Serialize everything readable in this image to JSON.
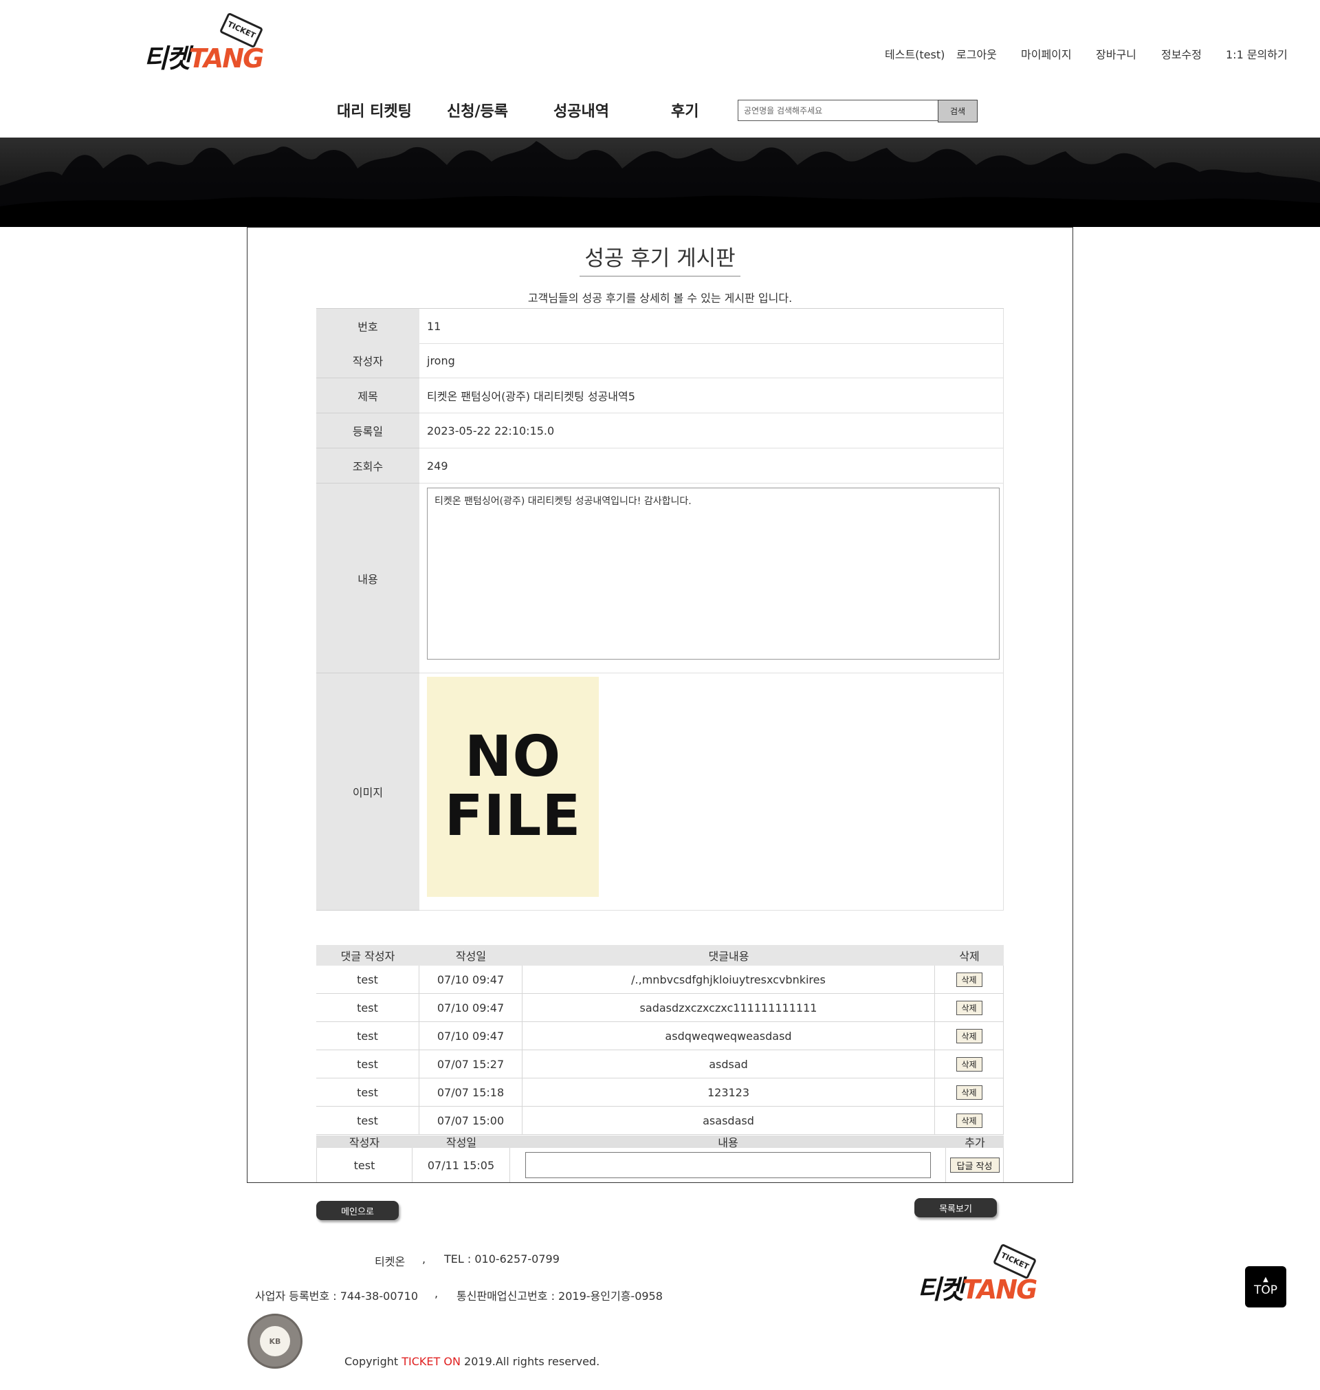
{
  "header": {
    "logo": {
      "kr": "티켓",
      "en": "TANG",
      "tag": "TICKET"
    },
    "top_links": [
      "테스트(test)",
      "로그아웃",
      "마이페이지",
      "장바구니",
      "정보수정",
      "1:1 문의하기"
    ],
    "nav": [
      "대리 티켓팅",
      "신청/등록",
      "성공내역",
      "후기"
    ],
    "search": {
      "placeholder": "공연명을 검색해주세요",
      "button": "검색"
    }
  },
  "board": {
    "title": "성공 후기 게시판",
    "description": "고객님들의 성공 후기를 상세히 볼 수 있는 게시판 입니다.",
    "fields": {
      "number": {
        "label": "번호",
        "value": "11"
      },
      "author": {
        "label": "작성자",
        "value": "jrong"
      },
      "subject": {
        "label": "제목",
        "value": "티켓온 팬텀싱어(광주) 대리티켓팅 성공내역5"
      },
      "date": {
        "label": "등록일",
        "value": "2023-05-22 22:10:15.0"
      },
      "views": {
        "label": "조회수",
        "value": "249"
      },
      "content": {
        "label": "내용",
        "value": "티켓온 팬텀싱어(광주) 대리티켓팅 성공내역입니다! 감사합니다."
      },
      "image": {
        "label": "이미지",
        "placeholder_line1": "NO",
        "placeholder_line2": "FILE"
      }
    }
  },
  "comments": {
    "headers": [
      "댓글 작성자",
      "작성일",
      "댓글내용",
      "삭제"
    ],
    "rows": [
      {
        "author": "test",
        "date": "07/10 09:47",
        "content": "/.,mnbvcsdfghjkloiuytresxcvbnkires",
        "delete": "삭제"
      },
      {
        "author": "test",
        "date": "07/10 09:47",
        "content": "sadasdzxczxczxc111111111111",
        "delete": "삭제"
      },
      {
        "author": "test",
        "date": "07/10 09:47",
        "content": "asdqweqweqweasdasd",
        "delete": "삭제"
      },
      {
        "author": "test",
        "date": "07/07 15:27",
        "content": "asdsad",
        "delete": "삭제"
      },
      {
        "author": "test",
        "date": "07/07 15:18",
        "content": "123123",
        "delete": "삭제"
      },
      {
        "author": "test",
        "date": "07/07 15:00",
        "content": "asasdasd",
        "delete": "삭제"
      }
    ]
  },
  "reply": {
    "headers": [
      "작성자",
      "작성일",
      "내용",
      "추가"
    ],
    "author": "test",
    "date": "07/11 15:05",
    "input_value": "",
    "button": "답글 작성"
  },
  "buttons": {
    "main": "메인으로",
    "list": "목록보기"
  },
  "footer": {
    "company": "티켓온",
    "sep": ",",
    "tel": "TEL : 010-6257-0799",
    "biz_number": "사업자 등록번호 : 744-38-00710",
    "mail_order": "통신판매업신고번호 : 2019-용인기흥-0958",
    "copyright_pre": "Copyright ",
    "copyright_brand": "TICKET ON",
    "copyright_post": " 2019.All rights reserved.",
    "seal_text": "KB",
    "top_button": "TOP"
  },
  "colors": {
    "brand_orange": "#e8522a",
    "copyright_red": "#e02020",
    "label_bg": "#e6e6e6"
  }
}
